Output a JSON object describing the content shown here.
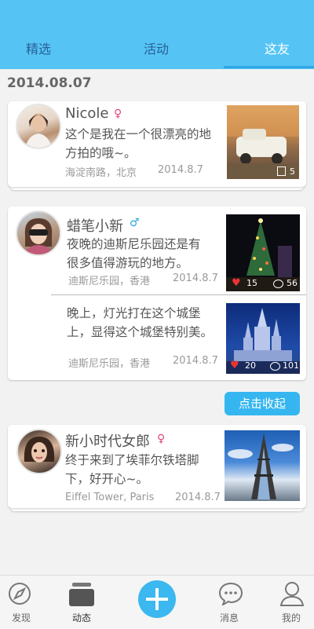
{
  "tabs": [
    "精选",
    "活动",
    "这友"
  ],
  "date_header": "2014.08.07",
  "posts": [
    {
      "name": "Nicole",
      "gender": "♀",
      "text_line1": "这个是我在一个很漂亮的地",
      "text_line2": "方拍的哦~。",
      "location": "海淀南路，北京",
      "date": "2014.8.7",
      "photo_count": "5"
    },
    {
      "name": "蜡笔小新",
      "gender": "♂",
      "entries": [
        {
          "text_line1": "夜晚的迪斯尼乐园还是有",
          "text_line2": "很多值得游玩的地方。",
          "location": "迪斯尼乐园，香港",
          "date": "2014.8.7",
          "likes": "15",
          "comments": "56"
        },
        {
          "text_line1": "晚上，灯光打在这个城堡",
          "text_line2": "上，显得这个城堡特别美。",
          "location": "迪斯尼乐园，香港",
          "date": "2014.8.7",
          "likes": "20",
          "comments": "101"
        }
      ]
    },
    {
      "name": "新小时代女郎",
      "gender": "♀",
      "text_line1": "终于来到了埃菲尔铁塔脚",
      "text_line2": "下，好开心~。",
      "location": "Eiffel Tower, Paris",
      "date": "2014.8.7"
    }
  ],
  "collapse_button": "点击收起",
  "bottom_nav": [
    "发现",
    "动态",
    "消息",
    "我的"
  ],
  "colors": {
    "accent": "#55c4f5",
    "female": "#e0457b",
    "male": "#2aa6e0"
  },
  "icons": [
    "compass-icon",
    "feed-icon",
    "add-icon",
    "message-icon",
    "profile-icon",
    "heart-icon",
    "comment-icon",
    "photo-stack-icon"
  ]
}
